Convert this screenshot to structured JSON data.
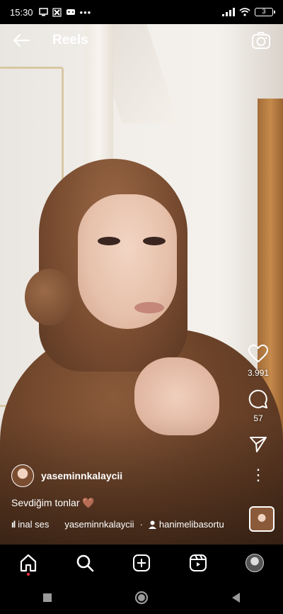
{
  "status_bar": {
    "time": "15:30",
    "battery": "3",
    "icons": [
      "screen-icon",
      "tiktok-icon",
      "game-icon",
      "more-dots",
      "signal-icon",
      "wifi-icon",
      "battery-icon"
    ]
  },
  "header": {
    "title": "Reels",
    "back_icon": "arrow-left-icon",
    "camera_icon": "camera-icon"
  },
  "actions": {
    "likes": "3.991",
    "comments": "57",
    "icons": [
      "heart-icon",
      "comment-icon",
      "share-icon",
      "more-icon"
    ]
  },
  "post": {
    "username": "yaseminnkalaycii",
    "caption": "Sevdiğim tonlar 🤎",
    "audio_label": "inal ses",
    "audio_user": "yaseminnkalaycii",
    "separator": "·",
    "tagged_user": "hanimelibasortu"
  },
  "bottom_nav": {
    "items": [
      "home-icon",
      "search-icon",
      "create-icon",
      "reels-icon",
      "profile-avatar"
    ],
    "notification_color": "#ff3040"
  },
  "system_nav": {
    "items": [
      "recents-icon",
      "home-circle-icon",
      "back-triangle-icon"
    ]
  }
}
